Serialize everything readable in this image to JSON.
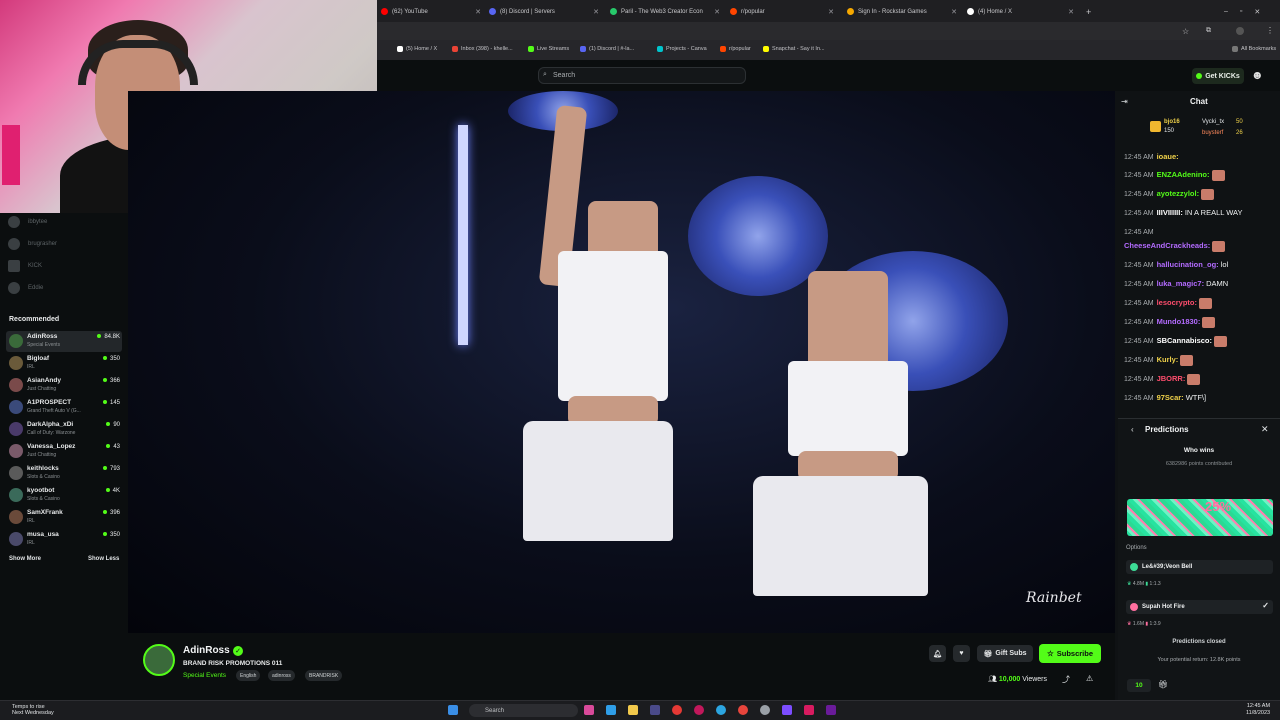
{
  "browser": {
    "tabs": [
      {
        "label": "(62) YouTube",
        "color": "#ff0000"
      },
      {
        "label": "(8) Discord | Servers",
        "color": "#5865f2"
      },
      {
        "label": "Paril - The Web3 Creator Econ",
        "color": "#27c96b"
      },
      {
        "label": "r/popular",
        "color": "#ff4500"
      },
      {
        "label": "Sign In - Rockstar Games",
        "color": "#f6a800"
      },
      {
        "label": "(4) Home / X",
        "color": "#ffffff"
      }
    ],
    "bookmarks": [
      {
        "label": "(5) Home / X",
        "color": "#ffffff"
      },
      {
        "label": "Inbox (398) - khelle...",
        "color": "#ea4335"
      },
      {
        "label": "Live Streams",
        "color": "#53fc18"
      },
      {
        "label": "(1) Discord | #-la...",
        "color": "#5865f2"
      },
      {
        "label": "Projects - Canva",
        "color": "#00c4cc"
      },
      {
        "label": "r/popular",
        "color": "#ff4500"
      },
      {
        "label": "Snapchat - Say it In...",
        "color": "#fffc00"
      }
    ],
    "all_bookmarks": "All Bookmarks"
  },
  "header": {
    "search_placeholder": "Search",
    "get_kicks": "Get KICKs"
  },
  "sidebar": {
    "following": [
      {
        "name": "ibbytee"
      },
      {
        "name": "brugrasher"
      },
      {
        "name": "KICK"
      },
      {
        "name": "Eddie"
      }
    ],
    "recommended_title": "Recommended",
    "recommended": [
      {
        "name": "AdinRoss",
        "category": "Special Events",
        "viewers": "84.8K",
        "color": "#3a6a3a"
      },
      {
        "name": "Bigloaf",
        "category": "IRL",
        "viewers": "350",
        "color": "#6a5a3a"
      },
      {
        "name": "AsianAndy",
        "category": "Just Chatting",
        "viewers": "366",
        "color": "#7a4a4a"
      },
      {
        "name": "A1PROSPECT",
        "category": "Grand Theft Auto V (G...",
        "viewers": "145",
        "color": "#3a4a7a"
      },
      {
        "name": "DarkAlpha_xDi",
        "category": "Call of Duty: Warzone",
        "viewers": "90",
        "color": "#4a3a6a"
      },
      {
        "name": "Vanessa_Lopez",
        "category": "Just Chatting",
        "viewers": "43",
        "color": "#7a5a6a"
      },
      {
        "name": "keithlocks",
        "category": "Slots & Casino",
        "viewers": "793",
        "color": "#5a5a5a"
      },
      {
        "name": "kyootbot",
        "category": "Slots & Casino",
        "viewers": "4K",
        "color": "#3a6a5a"
      },
      {
        "name": "SamXFrank",
        "category": "IRL",
        "viewers": "396",
        "color": "#6a4a3a"
      },
      {
        "name": "musa_usa",
        "category": "IRL",
        "viewers": "350",
        "color": "#4a4a6a"
      }
    ],
    "show_more": "Show More",
    "show_less": "Show Less"
  },
  "video": {
    "watermark": "Rainbet"
  },
  "stream": {
    "name": "AdinRoss",
    "title": "BRAND RISK PROMOTIONS 011",
    "category": "Special Events",
    "tags": [
      "English",
      "adinross",
      "BRANDRISK"
    ],
    "gift_subs": "Gift Subs",
    "subscribe": "Subscribe",
    "viewer_count": "10,000",
    "viewers_label": "Viewers"
  },
  "chat": {
    "title": "Chat",
    "pinned": [
      {
        "user": "bjo16",
        "sub": "150"
      },
      {
        "user": "Vycki_tx",
        "sub": "50"
      },
      {
        "user": "buysterf",
        "sub": "26"
      }
    ],
    "messages": [
      {
        "time": "12:45 AM",
        "user": "ioaue:",
        "color": "#f0d24a",
        "text": ""
      },
      {
        "time": "12:45 AM",
        "user": "ENZAAdenino:",
        "color": "#53fc18",
        "text": "",
        "emote": true
      },
      {
        "time": "12:45 AM",
        "user": "ayotezzylol:",
        "color": "#53fc18",
        "text": "",
        "emote": true
      },
      {
        "time": "12:45 AM",
        "user": "IIIVIIIIII:",
        "color": "#ffffff",
        "text": "IN A REALL WAY"
      },
      {
        "time": "12:45 AM",
        "user": "",
        "color": "#ffffff",
        "text": ""
      },
      {
        "time": "",
        "user": "CheeseAndCrackheads:",
        "color": "#b36bff",
        "text": "",
        "emote": true
      },
      {
        "time": "12:45 AM",
        "user": "hallucination_og:",
        "color": "#b36bff",
        "text": "lol"
      },
      {
        "time": "12:45 AM",
        "user": "luka_magic7:",
        "color": "#b36bff",
        "text": "DAMN"
      },
      {
        "time": "12:45 AM",
        "user": "lesocrypto:",
        "color": "#ff4d6d",
        "text": "",
        "emote": true
      },
      {
        "time": "12:45 AM",
        "user": "Mundo1830:",
        "color": "#b36bff",
        "text": "",
        "emote": true
      },
      {
        "time": "12:45 AM",
        "user": "SBCannabisco:",
        "color": "#ffffff",
        "text": "",
        "emote": true
      },
      {
        "time": "12:45 AM",
        "user": "Kurly:",
        "color": "#f0d24a",
        "text": "",
        "emote": true
      },
      {
        "time": "12:45 AM",
        "user": "JBORR:",
        "color": "#ff4d6d",
        "text": "",
        "emote": true
      },
      {
        "time": "12:45 AM",
        "user": "97Scar:",
        "color": "#f0d24a",
        "text": "WTF\\]"
      }
    ]
  },
  "predictions": {
    "title": "Predictions",
    "question": "Who wins",
    "points_contributed": "6382986 points contributed",
    "percent": "25%",
    "options_label": "Options",
    "options": [
      {
        "label": "Le&#39;Veon Bell",
        "points": "4.8M",
        "ratio": "1:1.3",
        "color": "#3ddc97",
        "selected": false
      },
      {
        "label": "Supah Hot Fire",
        "points": "1.6M",
        "ratio": "1:3.9",
        "color": "#ff6f9f",
        "selected": true
      }
    ],
    "closed": "Predictions closed",
    "potential_return": "Your potential return: 12.8K points",
    "bet_amount": "10"
  },
  "taskbar": {
    "weather_line1": "Temps to rise",
    "weather_line2": "Next Wednesday",
    "search_placeholder": "Search",
    "time": "12:45 AM",
    "date": "11/8/2023"
  }
}
